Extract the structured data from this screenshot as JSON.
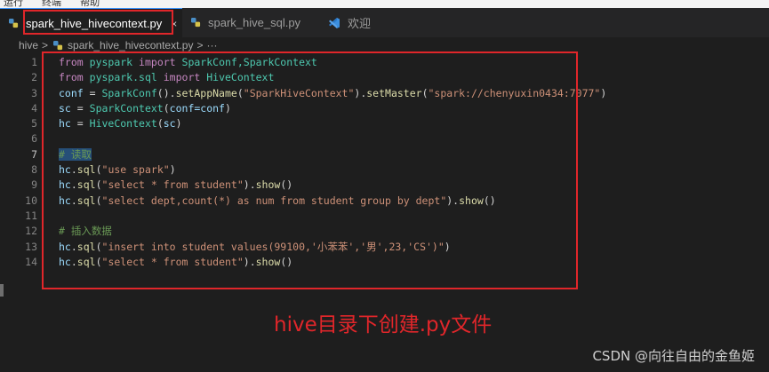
{
  "menu": {
    "items": [
      "运行",
      "终端",
      "帮助"
    ]
  },
  "tabs": [
    {
      "label": "spark_hive_hivecontext.py",
      "icon": "python-file-icon",
      "active": true,
      "close": "×"
    },
    {
      "label": "spark_hive_sql.py",
      "icon": "python-file-icon",
      "active": false
    },
    {
      "label": "欢迎",
      "icon": "vscode-icon",
      "active": false
    }
  ],
  "breadcrumb": {
    "folder": "hive",
    "sep1": ">",
    "file": "spark_hive_hivecontext.py",
    "sep2": ">",
    "more": "···"
  },
  "editor": {
    "line_numbers": [
      "1",
      "2",
      "3",
      "4",
      "5",
      "6",
      "7",
      "8",
      "9",
      "10",
      "11",
      "12",
      "13",
      "14"
    ],
    "lines": {
      "l1": {
        "from": "from",
        "mod": "pyspark",
        "import": "import",
        "names": "SparkConf,SparkContext"
      },
      "l2": {
        "from": "from",
        "mod": "pyspark.sql",
        "import": "import",
        "names": "HiveContext"
      },
      "l3": {
        "var": "conf",
        "eq": " = ",
        "cls": "SparkConf",
        "p1": "().",
        "fn1": "setAppName",
        "p2": "(",
        "s1": "\"SparkHiveContext\"",
        "p3": ").",
        "fn2": "setMaster",
        "p4": "(",
        "s2": "\"spark://chenyuxin0434:7077\"",
        "p5": ")"
      },
      "l4": {
        "var": "sc",
        "eq": " = ",
        "cls": "SparkContext",
        "p1": "(",
        "arg": "conf=conf",
        "p2": ")"
      },
      "l5": {
        "var": "hc",
        "eq": " = ",
        "cls": "HiveContext",
        "p1": "(",
        "arg": "sc",
        "p2": ")"
      },
      "l7": {
        "comment": "# 读取"
      },
      "l8": {
        "obj": "hc",
        "dot": ".",
        "fn": "sql",
        "p1": "(",
        "s": "\"use spark\"",
        "p2": ")"
      },
      "l9": {
        "obj": "hc",
        "dot": ".",
        "fn": "sql",
        "p1": "(",
        "s": "\"select * from student\"",
        "p2": ").",
        "fn2": "show",
        "p3": "()"
      },
      "l10": {
        "obj": "hc",
        "dot": ".",
        "fn": "sql",
        "p1": "(",
        "s": "\"select dept,count(*) as num from student group by dept\"",
        "p2": ").",
        "fn2": "show",
        "p3": "()"
      },
      "l12": {
        "comment": "# 插入数据"
      },
      "l13": {
        "obj": "hc",
        "dot": ".",
        "fn": "sql",
        "p1": "(",
        "s": "\"insert into student values(99100,'小苯苯','男',23,'CS')\"",
        "p2": ")"
      },
      "l14": {
        "obj": "hc",
        "dot": ".",
        "fn": "sql",
        "p1": "(",
        "s": "\"select * from student\"",
        "p2": ").",
        "fn2": "show",
        "p3": "()"
      }
    }
  },
  "annotation": {
    "caption": "hive目录下创建.py文件",
    "box_color": "#e0262a"
  },
  "watermark": "CSDN @向往自由的金鱼姬",
  "colors": {
    "keyword": "#c586c0",
    "class": "#4ec9b0",
    "function": "#dcdcaa",
    "string": "#ce9178",
    "variable": "#9cdcfe",
    "comment": "#6a9955",
    "accent": "#3794ff"
  }
}
